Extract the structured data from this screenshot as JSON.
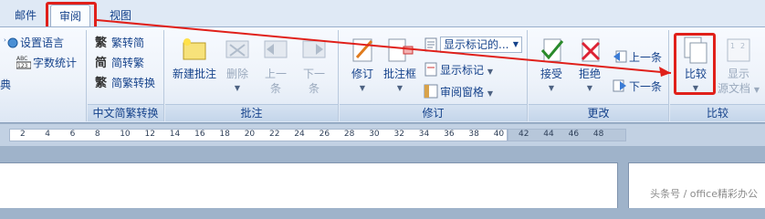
{
  "tabs": [
    {
      "label": "邮件"
    },
    {
      "label": "审阅"
    },
    {
      "label": "视图"
    }
  ],
  "groups": {
    "proofing": {
      "set_language": "设置语言",
      "word_count": "字数统计",
      "dictionary": "典"
    },
    "chinese_conversion": {
      "label": "中文简繁转换",
      "to_simplified": "繁转简",
      "to_traditional": "简转繁",
      "conversion": "简繁转换"
    },
    "comments": {
      "label": "批注",
      "new_comment": "新建批注",
      "delete": "删除",
      "previous_line1": "上一",
      "previous_line2": "条",
      "next_line1": "下一",
      "next_line2": "条"
    },
    "tracking": {
      "label": "修订",
      "track_changes": "修订",
      "balloons": "批注框",
      "display_markup_value": "显示标记的...",
      "show_markup": "显示标记",
      "reviewing_pane": "审阅窗格"
    },
    "changes": {
      "label": "更改",
      "accept": "接受",
      "reject": "拒绝",
      "previous": "上一条",
      "next": "下一条"
    },
    "compare": {
      "label": "比较",
      "compare": "比较",
      "show_source_line1": "显示",
      "show_source_line2": "源文档"
    }
  },
  "ruler": {
    "ticks": [
      "2",
      "4",
      "6",
      "8",
      "10",
      "12",
      "14",
      "16",
      "18",
      "20",
      "22",
      "24",
      "26",
      "28",
      "30",
      "32",
      "34",
      "36",
      "38",
      "40",
      "42",
      "44",
      "46",
      "48"
    ]
  },
  "watermark": "头条号 / office精彩办公",
  "colors": {
    "highlight": "#e0201a",
    "accent": "#15428b"
  }
}
